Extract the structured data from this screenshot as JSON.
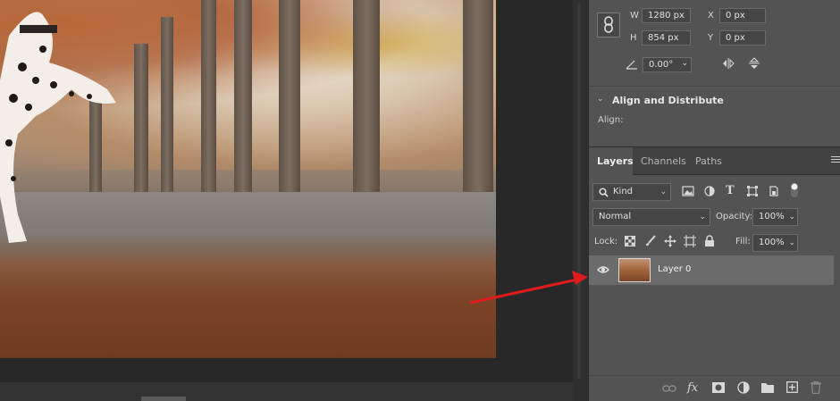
{
  "properties": {
    "width_label": "W",
    "width_value": "1280 px",
    "height_label": "H",
    "height_value": "854 px",
    "x_label": "X",
    "x_value": "0 px",
    "y_label": "Y",
    "y_value": "0 px",
    "angle_value": "0.00°"
  },
  "align": {
    "title": "Align and Distribute",
    "subtitle": "Align:"
  },
  "layers": {
    "tabs": [
      "Layers",
      "Channels",
      "Paths"
    ],
    "active_tab": "Layers",
    "filter_kind": "Kind",
    "blend_mode": "Normal",
    "opacity_label": "Opacity:",
    "opacity_value": "100%",
    "lock_label": "Lock:",
    "fill_label": "Fill:",
    "fill_value": "100%",
    "layer_name": "Layer 0"
  },
  "colors": {
    "panel_bg": "#535353",
    "selected_layer": "#6b6b6b",
    "annotation_arrow": "#e01b1b"
  },
  "icons": [
    "link-icon",
    "angle-icon",
    "flip-horizontal-icon",
    "flip-vertical-icon",
    "search-icon",
    "image-filter-icon",
    "adjustment-filter-icon",
    "type-filter-icon",
    "shape-filter-icon",
    "smart-object-filter-icon",
    "filter-toggle-icon",
    "lock-pixels-icon",
    "lock-brush-icon",
    "lock-move-icon",
    "lock-artboard-icon",
    "lock-all-icon",
    "eye-icon",
    "link-layers-icon",
    "fx-icon",
    "mask-icon",
    "adjustment-layer-icon",
    "folder-icon",
    "new-layer-icon",
    "trash-icon",
    "panel-menu-icon"
  ]
}
